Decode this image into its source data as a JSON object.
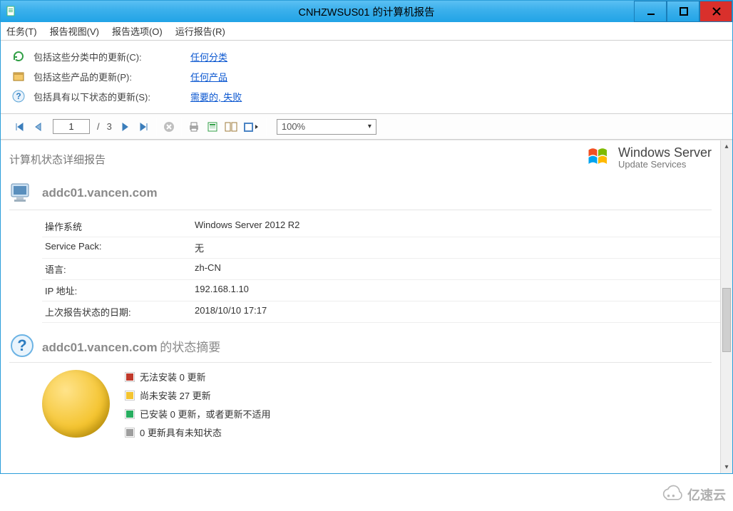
{
  "window": {
    "title": "CNHZWSUS01 的计算机报告"
  },
  "menu": {
    "tasks": "任务(T)",
    "view": "报告视图(V)",
    "options": "报告选项(O)",
    "run": "运行报告(R)"
  },
  "filters": {
    "classifications_label": "包括这些分类中的更新(C):",
    "classifications_link": "任何分类",
    "products_label": "包括这些产品的更新(P):",
    "products_link": "任何产品",
    "status_label": "包括具有以下状态的更新(S):",
    "status_link": "需要的, 失败"
  },
  "toolbar": {
    "current_page": "1",
    "page_sep": "/",
    "total_pages": "3",
    "zoom": "100%"
  },
  "report": {
    "title": "计算机状态详细报告",
    "wsus_big": "Windows Server",
    "wsus_small": "Update Services",
    "computer_name": "addc01.vancen.com",
    "details": {
      "os_k": "操作系统",
      "os_v": "Windows Server 2012 R2",
      "sp_k": "Service Pack:",
      "sp_v": "无",
      "lang_k": "语言:",
      "lang_v": "zh-CN",
      "ip_k": "IP 地址:",
      "ip_v": "192.168.1.10",
      "last_k": "上次报告状态的日期:",
      "last_v": "2018/10/10 17:17"
    },
    "summary_suffix": "的状态摘要",
    "legend": {
      "failed": "无法安装 0 更新",
      "pending": "尚未安装 27 更新",
      "installed": "已安装 0 更新，或者更新不适用",
      "unknown": "0 更新具有未知状态"
    }
  },
  "chart_data": {
    "type": "pie",
    "title": "addc01.vancen.com 的状态摘要",
    "series": [
      {
        "name": "无法安装",
        "value": 0,
        "color": "#c0392b"
      },
      {
        "name": "尚未安装",
        "value": 27,
        "color": "#f4c430"
      },
      {
        "name": "已安装/不适用",
        "value": 0,
        "color": "#27ae60"
      },
      {
        "name": "未知状态",
        "value": 0,
        "color": "#9e9e9e"
      }
    ]
  },
  "watermark": "亿速云"
}
